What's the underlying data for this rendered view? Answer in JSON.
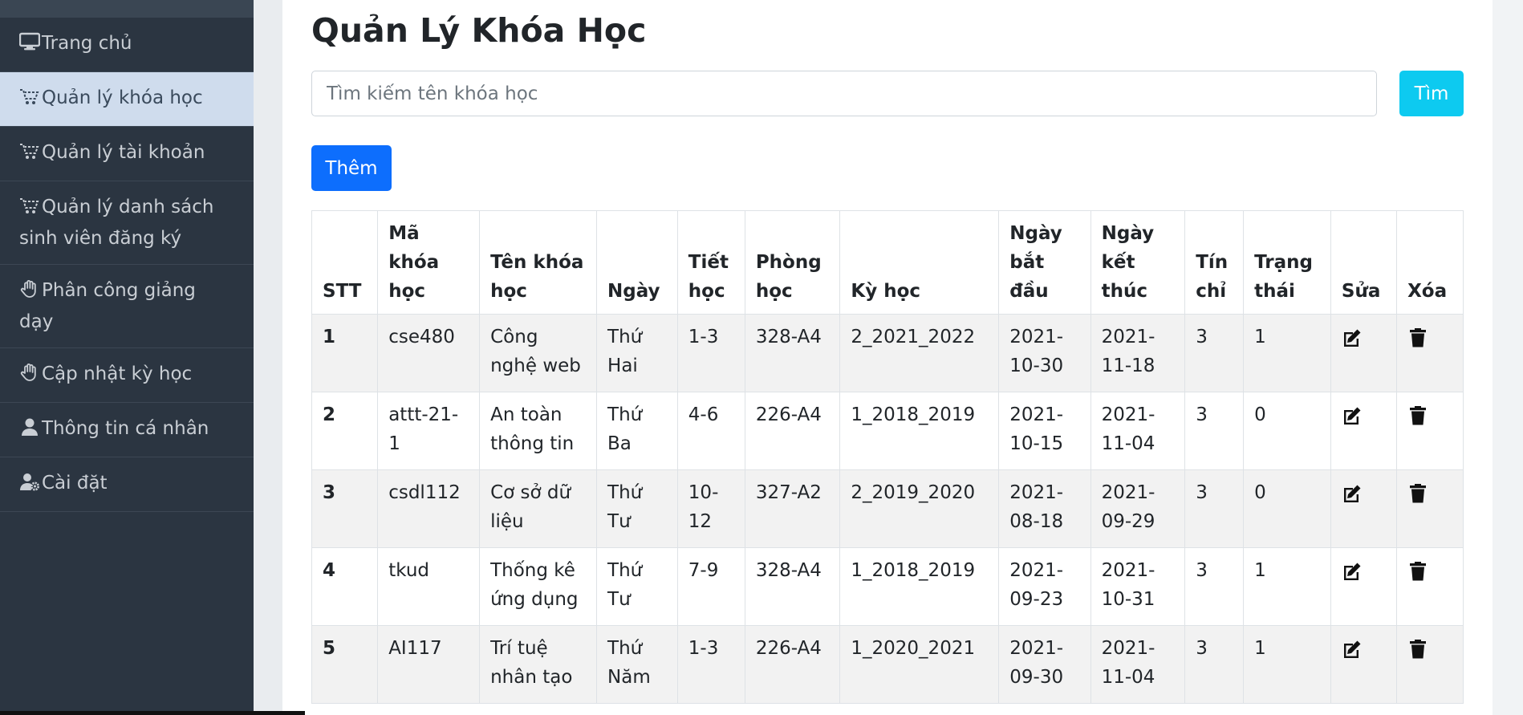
{
  "sidebar": {
    "items": [
      {
        "label": "Trang chủ",
        "icon": "desktop-icon",
        "active": false
      },
      {
        "label": "Quản lý khóa học",
        "icon": "cart-icon",
        "active": true
      },
      {
        "label": "Quản lý tài khoản",
        "icon": "cart-icon",
        "active": false
      },
      {
        "label": "Quản lý danh sách sinh viên đăng ký",
        "icon": "cart-icon",
        "active": false
      },
      {
        "label": "Phân công giảng dạy",
        "icon": "hand-icon",
        "active": false
      },
      {
        "label": "Cập nhật kỳ học",
        "icon": "hand-icon",
        "active": false
      },
      {
        "label": "Thông tin cá nhân",
        "icon": "user-icon",
        "active": false
      },
      {
        "label": "Cài đặt",
        "icon": "user-cog-icon",
        "active": false
      }
    ]
  },
  "main": {
    "title": "Quản Lý Khóa Học",
    "search": {
      "placeholder": "Tìm kiếm tên khóa học",
      "value": "",
      "button_label": "Tìm"
    },
    "add_button_label": "Thêm",
    "table": {
      "headers": [
        "STT",
        "Mã khóa học",
        "Tên khóa học",
        "Ngày",
        "Tiết học",
        "Phòng học",
        "Kỳ học",
        "Ngày bắt đầu",
        "Ngày kết thúc",
        "Tín chỉ",
        "Trạng thái",
        "Sửa",
        "Xóa"
      ],
      "rows": [
        [
          "1",
          "cse480",
          "Công nghệ web",
          "Thứ Hai",
          "1-3",
          "328-A4",
          "2_2021_2022",
          "2021-10-30",
          "2021-11-18",
          "3",
          "1"
        ],
        [
          "2",
          "attt-21-1",
          "An toàn thông tin",
          "Thứ Ba",
          "4-6",
          "226-A4",
          "1_2018_2019",
          "2021-10-15",
          "2021-11-04",
          "3",
          "0"
        ],
        [
          "3",
          "csdl112",
          "Cơ sở dữ liệu",
          "Thứ Tư",
          "10-12",
          "327-A2",
          "2_2019_2020",
          "2021-08-18",
          "2021-09-29",
          "3",
          "0"
        ],
        [
          "4",
          "tkud",
          "Thống kê ứng dụng",
          "Thứ Tư",
          "7-9",
          "328-A4",
          "1_2018_2019",
          "2021-09-23",
          "2021-10-31",
          "3",
          "1"
        ],
        [
          "5",
          "AI117",
          "Trí tuệ nhân tạo",
          "Thứ Năm",
          "1-3",
          "226-A4",
          "1_2020_2021",
          "2021-09-30",
          "2021-11-04",
          "3",
          "1"
        ]
      ]
    }
  },
  "colors": {
    "sidebar_bg": "#2b3541",
    "sidebar_active_bg": "#cfdced",
    "search_button": "#0dcaf0",
    "add_button": "#0d6efd"
  }
}
